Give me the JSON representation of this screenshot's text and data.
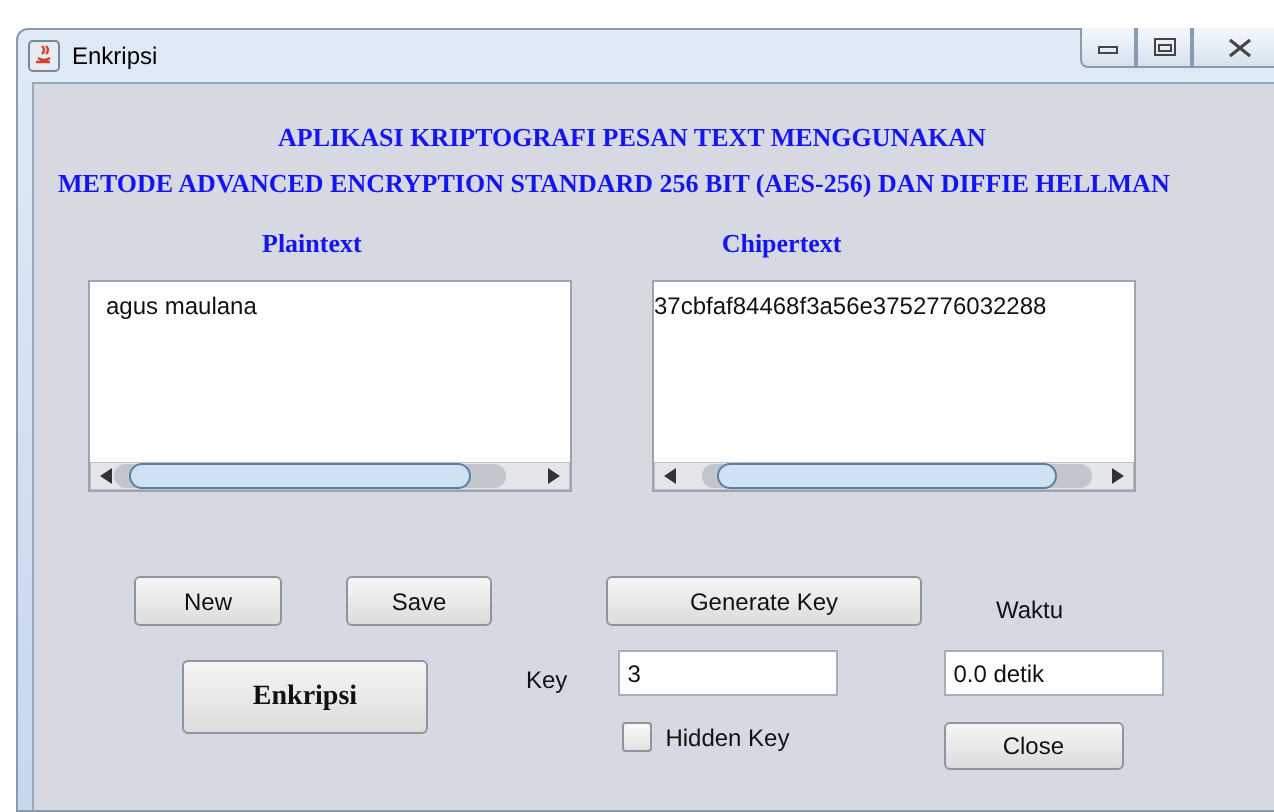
{
  "window": {
    "title": "Enkripsi"
  },
  "headings": [
    "APLIKASI KRIPTOGRAFI PESAN TEXT MENGGUNAKAN",
    "METODE ADVANCED ENCRYPTION STANDARD 256 BIT (AES-256) DAN DIFFIE HELLMAN"
  ],
  "plaintext": {
    "label": "Plaintext",
    "value": "agus maulana"
  },
  "ciphertext": {
    "label": "Chipertext",
    "value": "37cbfaf84468f3a56e3752776032288"
  },
  "buttons": {
    "new": "New",
    "save": "Save",
    "generate": "Generate Key",
    "encrypt": "Enkripsi",
    "close": "Close"
  },
  "key": {
    "label": "Key",
    "value": "3"
  },
  "hidden_key": {
    "label": "Hidden Key",
    "checked": false
  },
  "time": {
    "label": "Waktu",
    "value": "0.0 detik"
  }
}
